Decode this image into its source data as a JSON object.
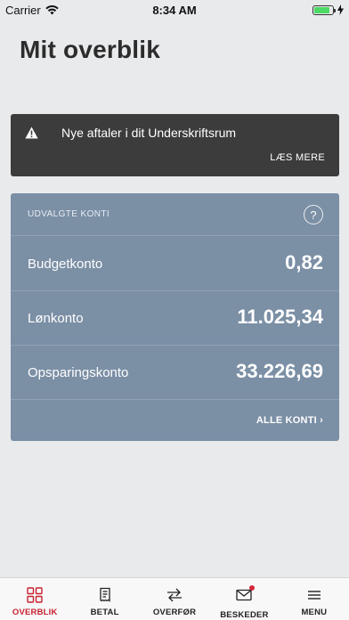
{
  "status_bar": {
    "carrier": "Carrier",
    "time": "8:34 AM",
    "battery_level": 0.85
  },
  "page": {
    "title": "Mit overblik"
  },
  "notice": {
    "text": "Nye aftaler i dit Underskriftsrum",
    "link": "LÆS MERE",
    "icon": "warning-icon"
  },
  "accounts": {
    "title": "UDVALGTE KONTI",
    "help": "?",
    "rows": [
      {
        "name": "Budgetkonto",
        "amount": "0,82"
      },
      {
        "name": "Lønkonto",
        "amount": "11.025,34"
      },
      {
        "name": "Opsparingskonto",
        "amount": "33.226,69"
      }
    ],
    "all_link": "ALLE KONTI ›"
  },
  "tabbar": {
    "items": [
      {
        "label": "OVERBLIK",
        "icon": "grid-icon",
        "active": true
      },
      {
        "label": "BETAL",
        "icon": "bill-icon",
        "active": false
      },
      {
        "label": "OVERFØR",
        "icon": "transfer-icon",
        "active": false
      },
      {
        "label": "BESKEDER",
        "icon": "mail-icon",
        "active": false
      },
      {
        "label": "MENU",
        "icon": "hamburger-icon",
        "active": false
      }
    ]
  },
  "colors": {
    "accent": "#c8202e",
    "card": "#7b8fa5",
    "notice_bg": "#3c3c3c",
    "background": "#e9eaec"
  }
}
